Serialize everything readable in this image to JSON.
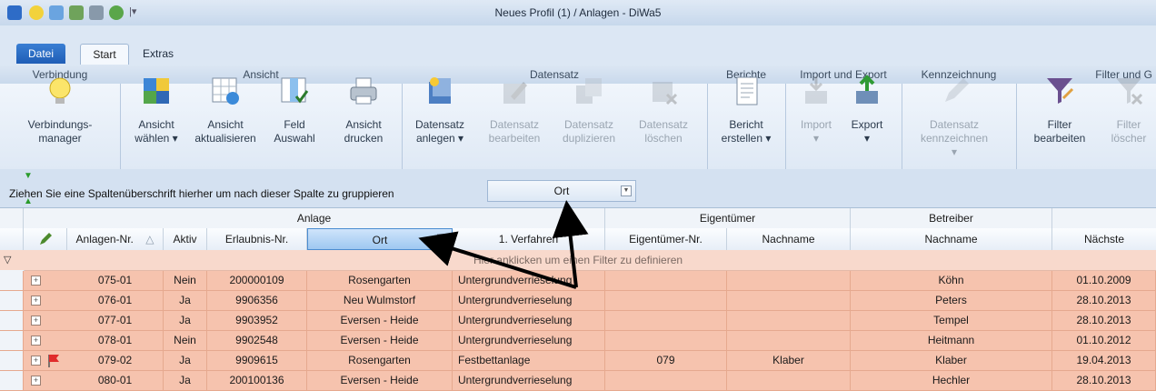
{
  "window": {
    "title": "Neues Profil (1) / Anlagen - DiWa5"
  },
  "tabs": [
    {
      "label": "Datei"
    },
    {
      "label": "Start"
    },
    {
      "label": "Extras"
    }
  ],
  "ribbon": {
    "groups": [
      {
        "label": "Verbindung",
        "buttons": [
          {
            "label": "Verbindungs-\nmanager",
            "icon": "lightbulb-icon"
          }
        ]
      },
      {
        "label": "Ansicht",
        "buttons": [
          {
            "label": "Ansicht\nwählen ▾",
            "icon": "view-select-icon"
          },
          {
            "label": "Ansicht\naktualisieren",
            "icon": "view-refresh-icon"
          },
          {
            "label": "Feld\nAuswahl",
            "icon": "field-select-icon"
          },
          {
            "label": "Ansicht\ndrucken",
            "icon": "printer-icon"
          }
        ]
      },
      {
        "label": "Datensatz",
        "buttons": [
          {
            "label": "Datensatz\nanlegen ▾",
            "icon": "record-new-icon"
          },
          {
            "label": "Datensatz\nbearbeiten",
            "icon": "record-edit-icon"
          },
          {
            "label": "Datensatz\nduplizieren",
            "icon": "record-duplicate-icon"
          },
          {
            "label": "Datensatz\nlöschen",
            "icon": "record-delete-icon"
          }
        ]
      },
      {
        "label": "Berichte",
        "buttons": [
          {
            "label": "Bericht\nerstellen ▾",
            "icon": "report-icon"
          }
        ]
      },
      {
        "label": "Import und Export",
        "buttons": [
          {
            "label": "Import\n▾",
            "icon": "import-icon"
          },
          {
            "label": "Export\n▾",
            "icon": "export-icon"
          }
        ]
      },
      {
        "label": "Kennzeichnung",
        "buttons": [
          {
            "label": "Datensatz\nkennzeichnen ▾",
            "icon": "mark-icon"
          }
        ]
      },
      {
        "label": "Filter und G",
        "buttons": [
          {
            "label": "Filter\nbearbeiten",
            "icon": "filter-edit-icon"
          },
          {
            "label": "Filter\nlöscher",
            "icon": "filter-clear-icon"
          }
        ]
      }
    ]
  },
  "grouping": {
    "hint": "Ziehen Sie eine Spaltenüberschrift hierher um nach dieser Spalte zu gruppieren",
    "grouped_column": "Ort"
  },
  "grid": {
    "bands": [
      "Anlage",
      "Eigentümer",
      "Betreiber"
    ],
    "columns": [
      "Anlagen-Nr.",
      "Aktiv",
      "Erlaubnis-Nr.",
      "Ort",
      "1. Verfahren",
      "Eigentümer-Nr.",
      "Nachname",
      "Nachname",
      "Nächste"
    ],
    "sort_indicator": "△",
    "filter_hint": "Hier anklicken um einen Filter zu definieren",
    "rows": [
      {
        "anlagen_nr": "075-01",
        "aktiv": "Nein",
        "erlaubnis": "200000109",
        "ort": "Rosengarten",
        "verfahren": "Untergrundverrieselung",
        "eig_nr": "",
        "eig_name": "",
        "betr_name": "Köhn",
        "naechste": "01.10.2009",
        "flag": false
      },
      {
        "anlagen_nr": "076-01",
        "aktiv": "Ja",
        "erlaubnis": "9906356",
        "ort": "Neu Wulmstorf",
        "verfahren": "Untergrundverrieselung",
        "eig_nr": "",
        "eig_name": "",
        "betr_name": "Peters",
        "naechste": "28.10.2013",
        "flag": false
      },
      {
        "anlagen_nr": "077-01",
        "aktiv": "Ja",
        "erlaubnis": "9903952",
        "ort": "Eversen - Heide",
        "verfahren": "Untergrundverrieselung",
        "eig_nr": "",
        "eig_name": "",
        "betr_name": "Tempel",
        "naechste": "28.10.2013",
        "flag": false
      },
      {
        "anlagen_nr": "078-01",
        "aktiv": "Nein",
        "erlaubnis": "9902548",
        "ort": "Eversen - Heide",
        "verfahren": "Untergrundverrieselung",
        "eig_nr": "",
        "eig_name": "",
        "betr_name": "Heitmann",
        "naechste": "01.10.2012",
        "flag": false
      },
      {
        "anlagen_nr": "079-02",
        "aktiv": "Ja",
        "erlaubnis": "9909615",
        "ort": "Rosengarten",
        "verfahren": "Festbettanlage",
        "eig_nr": "079",
        "eig_name": "Klaber",
        "betr_name": "Klaber",
        "naechste": "19.04.2013",
        "flag": true
      },
      {
        "anlagen_nr": "080-01",
        "aktiv": "Ja",
        "erlaubnis": "200100136",
        "ort": "Eversen - Heide",
        "verfahren": "Untergrundverrieselung",
        "eig_nr": "",
        "eig_name": "",
        "betr_name": "Hechler",
        "naechste": "28.10.2013",
        "flag": false
      }
    ]
  },
  "colors": {
    "row_bg": "#f6c3ae",
    "filter_bg": "#f8d9cc",
    "ribbon_bg": "#dfe9f5",
    "accent": "#1f5db6"
  }
}
